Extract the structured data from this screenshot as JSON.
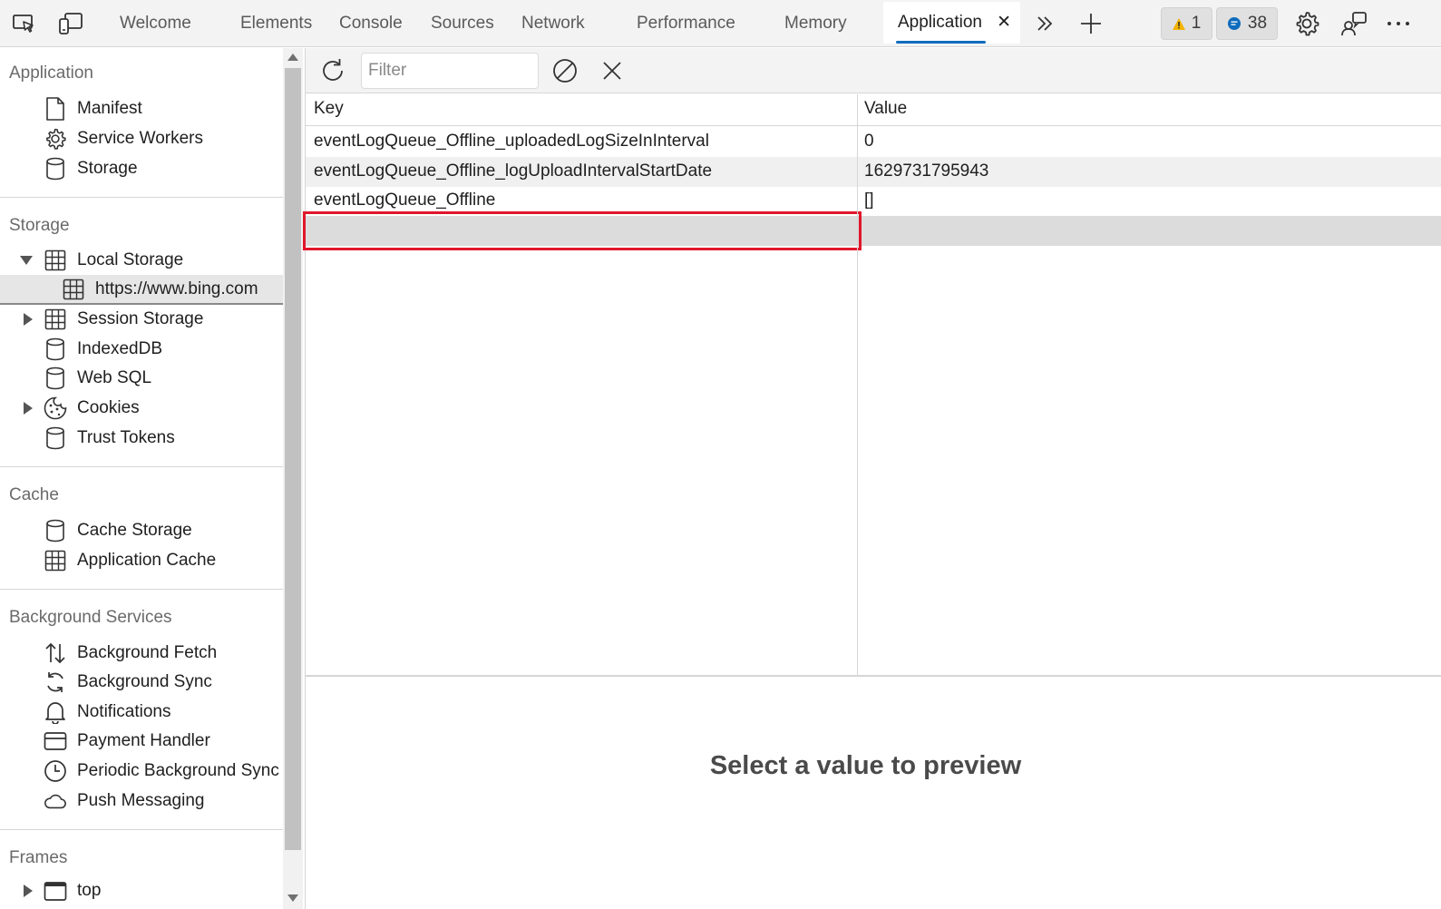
{
  "toolbar": {
    "tabs": [
      {
        "label": "Welcome"
      },
      {
        "label": "Elements"
      },
      {
        "label": "Console"
      },
      {
        "label": "Sources"
      },
      {
        "label": "Network"
      },
      {
        "label": "Performance"
      },
      {
        "label": "Memory"
      },
      {
        "label": "Application"
      }
    ],
    "close_tab_glyph": "✕",
    "warnings_count": "1",
    "messages_count": "38",
    "icons": [
      "inspect-icon",
      "device-emulation-icon",
      "more-tabs-icon",
      "add-tab-icon",
      "warning-icon",
      "message-icon",
      "settings-icon",
      "feedback-icon",
      "more-options-icon"
    ]
  },
  "sidebar": {
    "sections": [
      {
        "title": "Application",
        "items": [
          {
            "label": "Manifest",
            "icon": "document-icon"
          },
          {
            "label": "Service Workers",
            "icon": "gear-icon"
          },
          {
            "label": "Storage",
            "icon": "database-icon"
          }
        ]
      },
      {
        "title": "Storage",
        "items": [
          {
            "label": "Local Storage",
            "icon": "table-icon",
            "expanded": true
          },
          {
            "label": "https://www.bing.com",
            "icon": "table-icon",
            "selected": true
          },
          {
            "label": "Session Storage",
            "icon": "table-icon",
            "expanded": false
          },
          {
            "label": "IndexedDB",
            "icon": "database-icon"
          },
          {
            "label": "Web SQL",
            "icon": "database-icon"
          },
          {
            "label": "Cookies",
            "icon": "cookie-icon",
            "expanded": false
          },
          {
            "label": "Trust Tokens",
            "icon": "database-icon"
          }
        ]
      },
      {
        "title": "Cache",
        "items": [
          {
            "label": "Cache Storage",
            "icon": "database-icon"
          },
          {
            "label": "Application Cache",
            "icon": "table-icon"
          }
        ]
      },
      {
        "title": "Background Services",
        "items": [
          {
            "label": "Background Fetch",
            "icon": "arrows-updown-icon"
          },
          {
            "label": "Background Sync",
            "icon": "sync-icon"
          },
          {
            "label": "Notifications",
            "icon": "bell-icon"
          },
          {
            "label": "Payment Handler",
            "icon": "card-icon"
          },
          {
            "label": "Periodic Background Sync",
            "icon": "clock-icon"
          },
          {
            "label": "Push Messaging",
            "icon": "cloud-icon"
          }
        ]
      },
      {
        "title": "Frames",
        "items": [
          {
            "label": "top",
            "icon": "frame-icon",
            "expanded": false
          }
        ]
      }
    ]
  },
  "storage_view": {
    "filter_placeholder": "Filter",
    "filter_value": "",
    "columns": [
      "Key",
      "Value"
    ],
    "rows": [
      {
        "key": "eventLogQueue_Offline_uploadedLogSizeInInterval",
        "value": "0"
      },
      {
        "key": "eventLogQueue_Offline_logUploadIntervalStartDate",
        "value": "1629731795943"
      },
      {
        "key": "eventLogQueue_Offline",
        "value": "[]"
      },
      {
        "key": "",
        "value": ""
      }
    ],
    "preview_message": "Select a value to preview"
  },
  "colors": {
    "accent": "#0f6cbd",
    "highlight_box": "#e0162b",
    "warning": "#f2b200",
    "message": "#0f6cbd"
  }
}
